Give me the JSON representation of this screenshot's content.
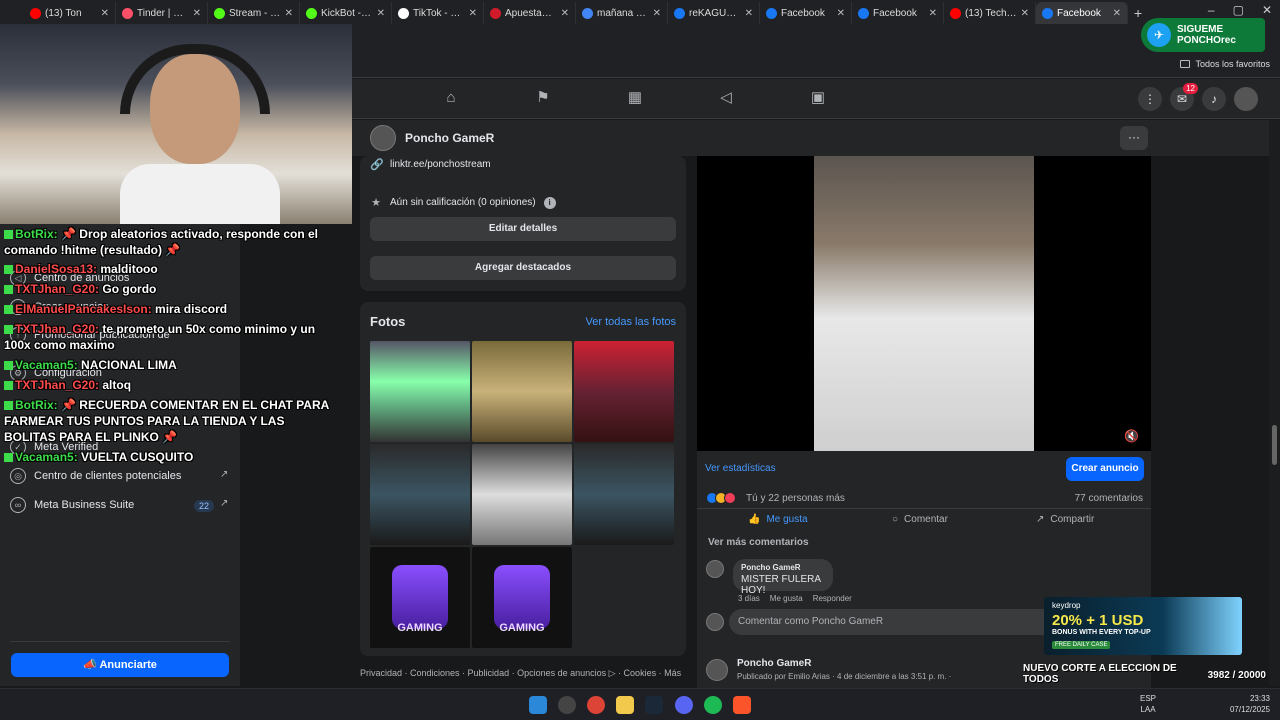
{
  "browser": {
    "tabs": [
      {
        "label": "(13) Ton",
        "color": "#ff0000"
      },
      {
        "label": "Tinder | Con",
        "color": "#fd5068"
      },
      {
        "label": "Stream - Kic",
        "color": "#53fc18"
      },
      {
        "label": "KickBot - Kic",
        "color": "#53fc18"
      },
      {
        "label": "TikTok - Mal",
        "color": "#ffffff"
      },
      {
        "label": "Apuestas de",
        "color": "#d11a2a"
      },
      {
        "label": "mañana es f",
        "color": "#4285f4"
      },
      {
        "label": "reKAGUE D",
        "color": "#1877f2"
      },
      {
        "label": "Facebook",
        "color": "#1877f2"
      },
      {
        "label": "Facebook",
        "color": "#1877f2"
      },
      {
        "label": "(13) Tech Ho",
        "color": "#ff0000"
      },
      {
        "label": "Facebook",
        "color": "#1877f2",
        "active": true
      }
    ],
    "favorites_label": "Todos los favoritos"
  },
  "fb_nav": {
    "icons": [
      "home-icon",
      "flag-icon",
      "stats-icon",
      "megaphone-icon",
      "calendar-icon"
    ],
    "notification_badge": "12"
  },
  "page": {
    "name": "Poncho GameR",
    "link": "linktr.ee/ponchostream",
    "rating": "Aún sin calificación (0 opiniones)",
    "edit_details": "Editar detalles",
    "add_featured": "Agregar destacados",
    "photos_title": "Fotos",
    "photos_link": "Ver todas las fotos",
    "footer": "Privacidad · Condiciones · Publicidad · Opciones de anuncios ▷ · Cookies · Más"
  },
  "post": {
    "view_stats": "Ver estadísticas",
    "create_ad": "Crear anuncio",
    "reactions_text": "Tú y 22 personas más",
    "comments_count": "77 comentarios",
    "like": "Me gusta",
    "comment": "Comentar",
    "share": "Compartir",
    "more_comments": "Ver más comentarios",
    "comment_author": "Poncho GameR",
    "comment_text": "MISTER FULERA HOY!",
    "comment_time": "3 días",
    "comment_like": "Me gusta",
    "comment_reply": "Responder",
    "comment_placeholder": "Comentar como Poncho GameR"
  },
  "post2": {
    "name": "Poncho GameR",
    "sub": "Publicado por Emilio Arias  · 4 de diciembre a las 3:51 p. m. · "
  },
  "sidebar": {
    "items": [
      {
        "label": "Centro de anuncios",
        "icon": "megaphone-icon"
      },
      {
        "label": "Crear anuncios",
        "icon": "pencil-icon"
      },
      {
        "label": "Promocionar publicación de",
        "icon": "boost-icon"
      },
      {
        "label": "Configuración",
        "icon": "gear-icon"
      },
      {
        "label": "Meta Verified",
        "icon": "verified-icon"
      },
      {
        "label": "Centro de clientes potenciales",
        "icon": "leads-icon"
      },
      {
        "label": "Meta Business Suite",
        "icon": "meta-icon",
        "badge": "22"
      }
    ],
    "cta": "Anunciarte"
  },
  "chat": [
    {
      "user": "BotRix:",
      "text": " 📌 Drop aleatorios activado, responde con el comando !hitme (resultado) 📌",
      "red": false
    },
    {
      "user": "DanielSosa13:",
      "text": " malditooo",
      "red": true
    },
    {
      "user": "TXTJhan_G20:",
      "text": " Go gordo",
      "red": true
    },
    {
      "user": "ElManuelPancakesIson:",
      "text": " mira discord",
      "red": true
    },
    {
      "user": "TXTJhan_G20:",
      "text": " te prometo un 50x como minimo y un 100x como maximo",
      "red": true
    },
    {
      "user": "Vacaman5:",
      "text": " NACIONAL LIMA",
      "red": false
    },
    {
      "user": "TXTJhan_G20:",
      "text": " altoq",
      "red": true
    },
    {
      "user": "BotRix:",
      "text": " 📌 RECUERDA COMENTAR EN EL CHAT PARA FARMEAR TUS PUNTOS PARA LA TIENDA Y LAS BOLITAS PARA EL PLINKO 📌",
      "red": false
    },
    {
      "user": "Vacaman5:",
      "text": " VUELTA CUSQUITO",
      "red": false
    }
  ],
  "overlay": {
    "follow_line1": "SIGUEME",
    "follow_line2": "PONCHOrec",
    "keydrop_brand": "keydrop",
    "keydrop_offer": "20% + 1 USD",
    "keydrop_sub": "BONUS WITH EVERY TOP-UP",
    "keydrop_tag": "FREE DAILY CASE",
    "goal_title": "NUEVO CORTE A ELECCION DE TODOS",
    "goal_current": "3982",
    "goal_total": "/ 20000",
    "goal_fraction": 0.2
  },
  "taskbar": {
    "lang": "ESP",
    "lang2": "LAA",
    "time": "23:33",
    "date": "07/12/2025"
  }
}
